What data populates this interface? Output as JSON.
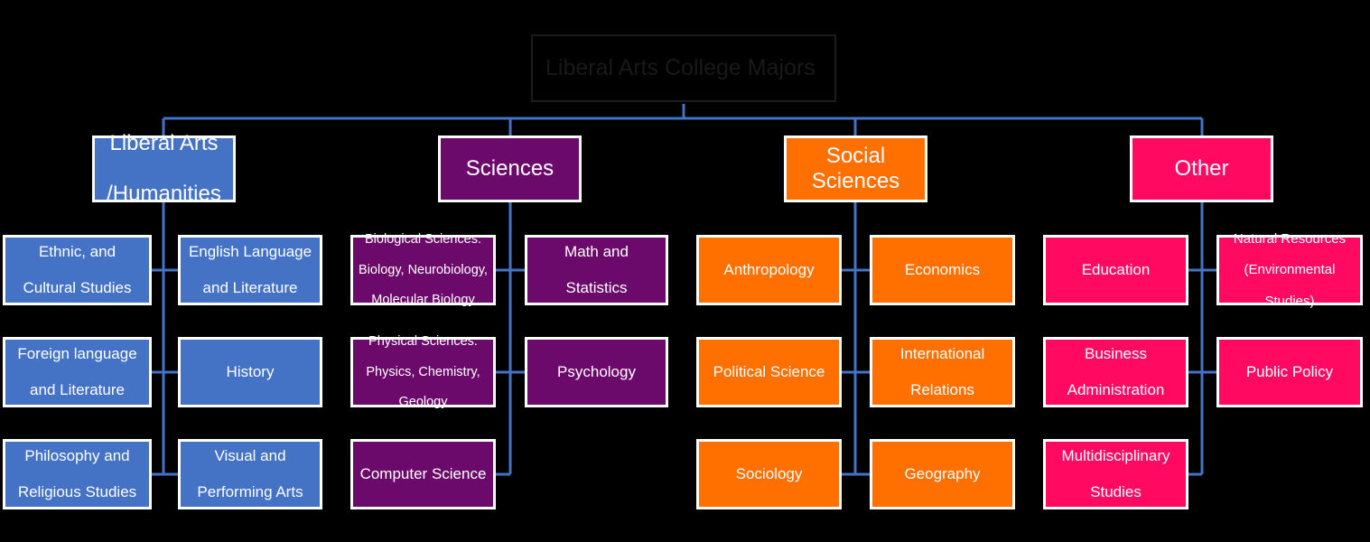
{
  "diagram": {
    "title": "Liberal Arts College Majors",
    "background_color": "#000000",
    "connector_color": "#4472C4",
    "node_border_color": "#FFFFFF",
    "title_text_color": "#191919",
    "colors": {
      "liberal_arts": "#4472C4",
      "sciences": "#6B0A6B",
      "social_sciences": "#FF7000",
      "other": "#FF0A60"
    }
  },
  "categories": [
    {
      "id": "liberal-arts-humanities",
      "label": "Liberal Arts\n/Humanities",
      "label_line1": "Liberal Arts",
      "label_line2": "/Humanities",
      "color": "#4472C4",
      "left_children": [
        {
          "line1": "Ethnic, and",
          "line2": "Cultural Studies",
          "line3": ""
        },
        {
          "line1": "Foreign language",
          "line2": "and Literature",
          "line3": ""
        },
        {
          "line1": "Philosophy and",
          "line2": "Religious Studies",
          "line3": ""
        }
      ],
      "right_children": [
        {
          "line1": "English Language",
          "line2": "and Literature",
          "line3": ""
        },
        {
          "line1": "History",
          "line2": "",
          "line3": ""
        },
        {
          "line1": "Visual and",
          "line2": "Performing Arts",
          "line3": ""
        }
      ]
    },
    {
      "id": "sciences",
      "label": "Sciences",
      "label_line1": "Sciences",
      "label_line2": "",
      "color": "#6B0A6B",
      "left_children": [
        {
          "line1": "Biological Sciences:",
          "line2": "Biology, Neurobiology,",
          "line3": "Molecular Biology"
        },
        {
          "line1": "Physical Sciences:",
          "line2": "Physics, Chemistry,",
          "line3": "Geology"
        },
        {
          "line1": "Computer Science",
          "line2": "",
          "line3": ""
        }
      ],
      "right_children": [
        {
          "line1": "Math and",
          "line2": "Statistics",
          "line3": ""
        },
        {
          "line1": "Psychology",
          "line2": "",
          "line3": ""
        }
      ]
    },
    {
      "id": "social-sciences",
      "label": "Social Sciences",
      "label_line1": "Social Sciences",
      "label_line2": "",
      "color": "#FF7000",
      "left_children": [
        {
          "line1": "Anthropology",
          "line2": "",
          "line3": ""
        },
        {
          "line1": "Political Science",
          "line2": "",
          "line3": ""
        },
        {
          "line1": "Sociology",
          "line2": "",
          "line3": ""
        }
      ],
      "right_children": [
        {
          "line1": "Economics",
          "line2": "",
          "line3": ""
        },
        {
          "line1": "International",
          "line2": "Relations",
          "line3": ""
        },
        {
          "line1": "Geography",
          "line2": "",
          "line3": ""
        }
      ]
    },
    {
      "id": "other",
      "label": "Other",
      "label_line1": "Other",
      "label_line2": "",
      "color": "#FF0A60",
      "left_children": [
        {
          "line1": "Education",
          "line2": "",
          "line3": ""
        },
        {
          "line1": "Business",
          "line2": "Administration",
          "line3": ""
        },
        {
          "line1": "Multidisciplinary",
          "line2": "Studies",
          "line3": ""
        }
      ],
      "right_children": [
        {
          "line1": "Natural Resources",
          "line2": "(Environmental",
          "line3": "Studies)"
        },
        {
          "line1": "Public Policy",
          "line2": "",
          "line3": ""
        }
      ]
    }
  ]
}
